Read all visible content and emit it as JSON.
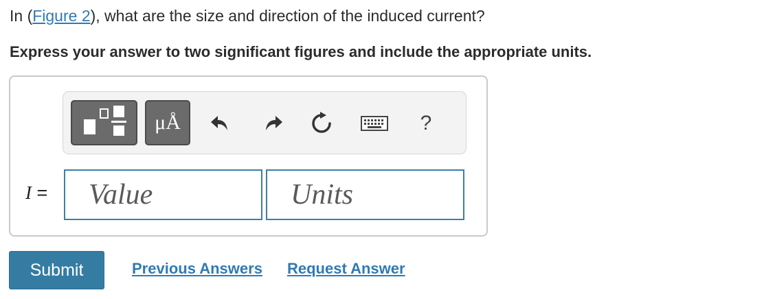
{
  "question": {
    "prefix": "In (",
    "figure_link": "Figure 2",
    "suffix": "), what are the size and direction of the induced current?"
  },
  "instruction": "Express your answer to two significant figures and include the appropriate units.",
  "toolbar": {
    "templates_icon": "templates-icon",
    "units_label": "μÅ",
    "undo_icon": "undo-icon",
    "redo_icon": "redo-icon",
    "reset_icon": "reset-icon",
    "keyboard_icon": "keyboard-icon",
    "help_label": "?"
  },
  "answer": {
    "variable": "I",
    "equals": "=",
    "value_placeholder": "Value",
    "units_placeholder": "Units"
  },
  "actions": {
    "submit_label": "Submit",
    "previous_answers_label": "Previous Answers",
    "request_answer_label": "Request Answer"
  },
  "colors": {
    "accent": "#357ca3",
    "link": "#2f7ab4",
    "toolbar_button": "#6b6b6b"
  }
}
